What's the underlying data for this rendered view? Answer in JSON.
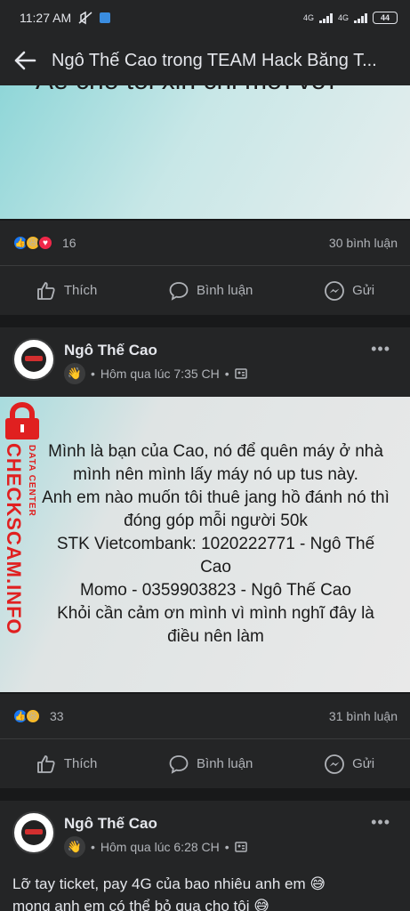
{
  "status_bar": {
    "time": "11:27 AM",
    "network_1": "4G",
    "network_2": "4G",
    "battery": "44"
  },
  "app_bar": {
    "title": "Ngô Thế Cao trong TEAM Hack Băng T..."
  },
  "post1": {
    "partial_text": "Ae cho tôi xin chỉ mới với",
    "reaction_count": "16",
    "comment_count": "30 bình luận",
    "actions": {
      "like": "Thích",
      "comment": "Bình luận",
      "share": "Gửi"
    }
  },
  "post2": {
    "author": "Ngô Thế Cao",
    "time": "Hôm qua lúc 7:35 CH",
    "body": "Mình là bạn của Cao, nó để quên máy ở nhà mình nên mình lấy máy nó up tus này.\nAnh em nào muốn tôi thuê jang hồ đánh nó thì đóng góp mỗi người 50k\nSTK Vietcombank: 1020222771 - Ngô Thế Cao\nMomo - 0359903823 - Ngô Thế Cao\nKhỏi cần cảm ơn mình vì mình nghĩ đây là điều nên làm",
    "reaction_count": "33",
    "comment_count": "31 bình luận",
    "actions": {
      "like": "Thích",
      "comment": "Bình luận",
      "share": "Gửi"
    }
  },
  "post3": {
    "author": "Ngô Thế Cao",
    "time": "Hôm qua lúc 6:28 CH",
    "body_line1": "Lỡ tay ticket, pay 4G của bao nhiêu anh em 😅",
    "body_line2": "mong anh em có thể bỏ qua cho tôi 😅"
  },
  "watermark": {
    "main": "CHECKSCAM.INFO",
    "sub": "DATA CENTER"
  },
  "more_label": "•••",
  "colors": {
    "bg": "#18191a",
    "card": "#242526",
    "text": "#e4e6eb",
    "muted": "#b0b3b8",
    "like_blue": "#1877f2",
    "love_red": "#f02849",
    "haha_yellow": "#f7b928"
  }
}
